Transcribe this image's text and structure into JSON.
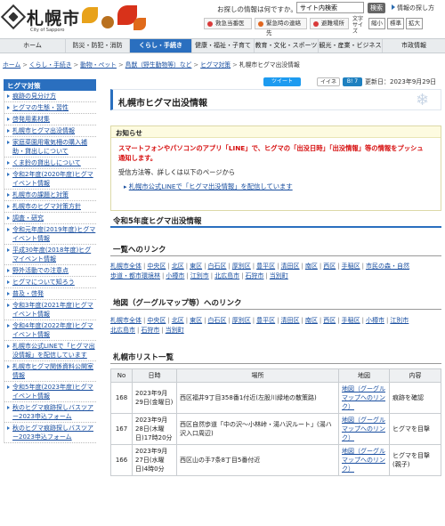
{
  "header": {
    "logo_text": "札幌市",
    "logo_sub": "City of Sapporo",
    "search_label": "お探しの情報は何ですか。",
    "search_value": "サイト内検索",
    "search_button": "検索",
    "howto_link": "情報の探し方",
    "quick_links": [
      {
        "label": "救急当番医",
        "color": "#d93a3a"
      },
      {
        "label": "緊急時の連絡先",
        "color": "#e0661f"
      },
      {
        "label": "避難場所",
        "color": "#d93a3a"
      }
    ],
    "text_size_label": "文字サイズ",
    "size_buttons": [
      "縮小",
      "標準",
      "拡大"
    ]
  },
  "nav": [
    "ホーム",
    "防災・防犯・消防",
    "くらし・手続き",
    "健康・福祉・子育て",
    "教育・文化・スポーツ",
    "観光・産業・ビジネス",
    "市政情報"
  ],
  "nav_active_index": 2,
  "breadcrumb": [
    "ホーム",
    "くらし・手続き",
    "動物・ペット",
    "鳥獣（野生動物等）など",
    "ヒグマ対策",
    "札幌市ヒグマ出没情報"
  ],
  "sidebar": {
    "title": "ヒグマ対策",
    "items": [
      "痕跡の見分け方",
      "ヒグマの生態・習性",
      "啓発用素材集",
      "札幌市ヒグマ出没情報",
      "家庭菜園用電気柵の購入補助・貸出しについて",
      "くま鈴の貸出しについて",
      "令和2年度(2020年度)ヒグマイベント情報",
      "札幌市の課題と対策",
      "札幌市のヒグマ対策方針",
      "調査・研究",
      "令和元年度(2019年度)ヒグマイベント情報",
      "平成30年度(2018年度)ヒグマイベント情報",
      "野外活動での注意点",
      "ヒグマについて知ろう",
      "普及・啓発",
      "令和3年度(2021年度)ヒグマイベント情報",
      "令和4年度(2022年度)ヒグマイベント情報",
      "札幌市公式LINEで「ヒグマ出没情報」を配信しています",
      "札幌市ヒグマ関係資料公開室情報",
      "令和5年度(2023年度)ヒグマイベント情報",
      "秋のヒグマ痕跡探しバスツアー2023申込フォーム",
      "秋のヒグマ痕跡探しバスツアー2023申込フォーム"
    ]
  },
  "share": {
    "tweet": "ツイート",
    "like": "イイネ",
    "bi": "B! 7",
    "updated": "更新日：2023年9月29日"
  },
  "page_title": "札幌市ヒグマ出没情報",
  "notice": {
    "head": "お知らせ",
    "line1a": "スマートフォンやパソコンのアプリ「LINE」で、ヒグマの「出没日時」「出没情報」等の情報をプッシュ",
    "line1b": "通知します。",
    "line2": "受信方法等、詳しくは以下のページから",
    "link": "札幌市公式LINEで「ヒグマ出没情報」を配信しています"
  },
  "section1": "令和5年度ヒグマ出没情報",
  "section2": "一覧へのリンク",
  "list_links_row1": [
    "札幌市全体",
    "中央区",
    "北区",
    "東区",
    "白石区",
    "厚別区",
    "豊平区",
    "清田区",
    "南区",
    "西区",
    "手稲区",
    "市民の森・自然"
  ],
  "list_links_row2": [
    "歩道・都市環境林",
    "小樽市",
    "江別市",
    "北広島市",
    "石狩市",
    "当別町"
  ],
  "section3": "地図（グーグルマップ等）へのリンク",
  "map_links_row1": [
    "札幌市全体",
    "中央区",
    "北区",
    "東区",
    "白石区",
    "厚別区",
    "豊平区",
    "清田区",
    "南区",
    "西区",
    "手稲区",
    "小樽市",
    "江別市"
  ],
  "map_links_row2": [
    "北広島市",
    "石狩市",
    "当別町"
  ],
  "section4": "札幌市リスト一覧",
  "table": {
    "headers": [
      "No",
      "日時",
      "場所",
      "地図",
      "内容"
    ],
    "rows": [
      {
        "no": "168",
        "date": "2023年9月29日(金曜日)",
        "place": "西区福井9丁目358番1付近(左股川緑地の散策路)",
        "map": "地図（グーグルマップへのリンク）",
        "content": "痕跡を確認"
      },
      {
        "no": "167",
        "date": "2023年9月28日(木曜日)17時20分",
        "place": "西区自然歩道「中の沢～小林峠・湯ハ沢ルート」(湯ハ沢入口周辺)",
        "map": "地図（グーグルマップへのリンク）",
        "content": "ヒグマを目撃"
      },
      {
        "no": "166",
        "date": "2023年9月27日(水曜日)4時0分",
        "place": "西区山の手7条8丁目5番付近",
        "map": "地図（グーグルマップへのリンク）",
        "content": "ヒグマを目撃(親子)"
      }
    ]
  },
  "colors": {
    "accent": "#2a6fbf",
    "link": "#1a4fa0",
    "alert": "#d60d0d"
  }
}
